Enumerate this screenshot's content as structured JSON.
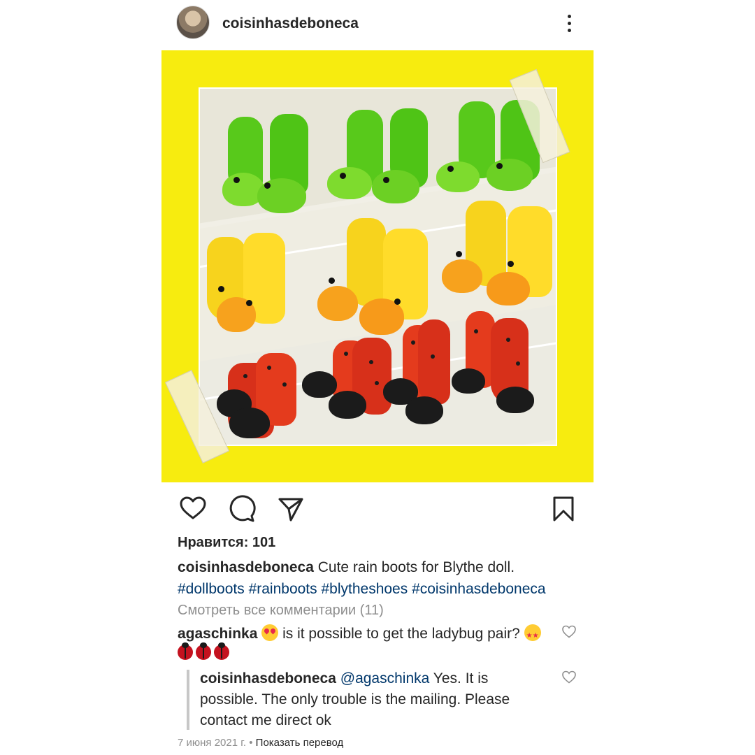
{
  "header": {
    "username": "coisinhasdeboneca",
    "avatar_icon": "user-avatar",
    "more_icon": "more-vertical-icon"
  },
  "post": {
    "image_icon": "photo-rain-boots",
    "background_color": "#f7ec0f"
  },
  "actions": {
    "like_icon": "heart-outline-icon",
    "comment_icon": "comment-icon",
    "share_icon": "send-icon",
    "save_icon": "bookmark-icon"
  },
  "likes": {
    "label": "Нравится: 101"
  },
  "caption": {
    "username": "coisinhasdeboneca",
    "text": " Cute rain boots for Blythe doll.",
    "hashtags": "#dollboots #rainboots #blytheshoes #coisinhasdeboneca"
  },
  "view_comments": "Смотреть все комментарии (11)",
  "comments": [
    {
      "username": "agaschinka",
      "text": " is it possible to get the ladybug pair? "
    },
    {
      "username": "coisinhasdeboneca",
      "mention": "@agaschinka",
      "text": " Yes. It is possible. The only trouble is the mailing. Please contact me direct ok"
    }
  ],
  "meta": {
    "date": "7 июня 2021 г.",
    "separator": " • ",
    "translate": "Показать перевод"
  },
  "colors": {
    "text": "#262626",
    "secondary": "#8e8e8e",
    "link": "#00376b",
    "accent_yellow": "#f7ec0f"
  }
}
